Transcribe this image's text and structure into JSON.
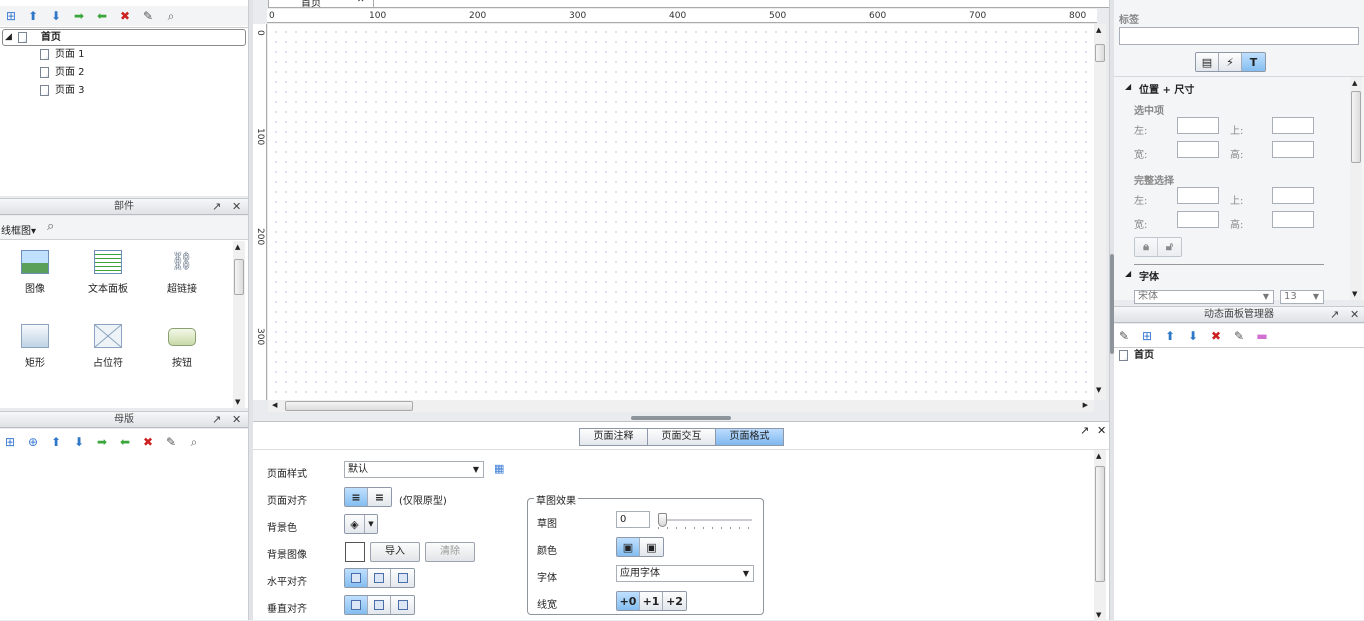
{
  "sitemap": {
    "toolbar_icons": [
      "add-page-icon",
      "move-up-icon",
      "move-down-icon",
      "indent-icon",
      "outdent-icon",
      "delete-icon",
      "rename-icon",
      "search-icon"
    ],
    "tree": [
      {
        "label": "首页",
        "level": 0,
        "selected": true,
        "expand": "◢"
      },
      {
        "label": "页面 1",
        "level": 1
      },
      {
        "label": "页面 2",
        "level": 1
      },
      {
        "label": "页面 3",
        "level": 1
      }
    ]
  },
  "widgets": {
    "title": "部件",
    "library": "线框图",
    "items": [
      {
        "label": "图像",
        "icon": "image-widget-icon"
      },
      {
        "label": "文本面板",
        "icon": "text-panel-icon"
      },
      {
        "label": "超链接",
        "icon": "hyperlink-icon"
      },
      {
        "label": "矩形",
        "icon": "rectangle-icon"
      },
      {
        "label": "占位符",
        "icon": "placeholder-icon"
      },
      {
        "label": "按钮",
        "icon": "button-widget-icon"
      }
    ]
  },
  "masters": {
    "title": "母版"
  },
  "canvas": {
    "tab_label": "首页",
    "ruler_h": [
      "0",
      "100",
      "200",
      "300",
      "400",
      "500",
      "600",
      "700",
      "800"
    ],
    "ruler_v": [
      "0",
      "100",
      "200",
      "300"
    ]
  },
  "page_props": {
    "tabs": [
      "页面注释",
      "页面交互",
      "页面格式"
    ],
    "active_tab": 2,
    "page_style_label": "页面样式",
    "page_style_value": "默认",
    "page_align_label": "页面对齐",
    "page_align_note": "(仅限原型)",
    "bg_color_label": "背景色",
    "bg_image_label": "背景图像",
    "import_label": "导入",
    "clear_label": "清除",
    "h_align_label": "水平对齐",
    "v_align_label": "垂直对齐",
    "sketch": {
      "title": "草图效果",
      "sketch_label": "草图",
      "sketch_value": "0",
      "color_label": "颜色",
      "font_label": "字体",
      "font_value": "应用字体",
      "line_width_label": "线宽",
      "line_width_options": [
        "+0",
        "+1",
        "+2"
      ]
    }
  },
  "inspector": {
    "label_title": "标签",
    "section_pos": "位置 + 尺寸",
    "selected_label": "选中项",
    "left": "左:",
    "top": "上:",
    "width": "宽:",
    "height": "高:",
    "full_select_label": "完整选择",
    "font_section": "字体",
    "font_family": "宋体",
    "font_size": "13"
  },
  "dynpanel": {
    "title": "动态面板管理器",
    "items": [
      {
        "label": "首页"
      }
    ]
  }
}
